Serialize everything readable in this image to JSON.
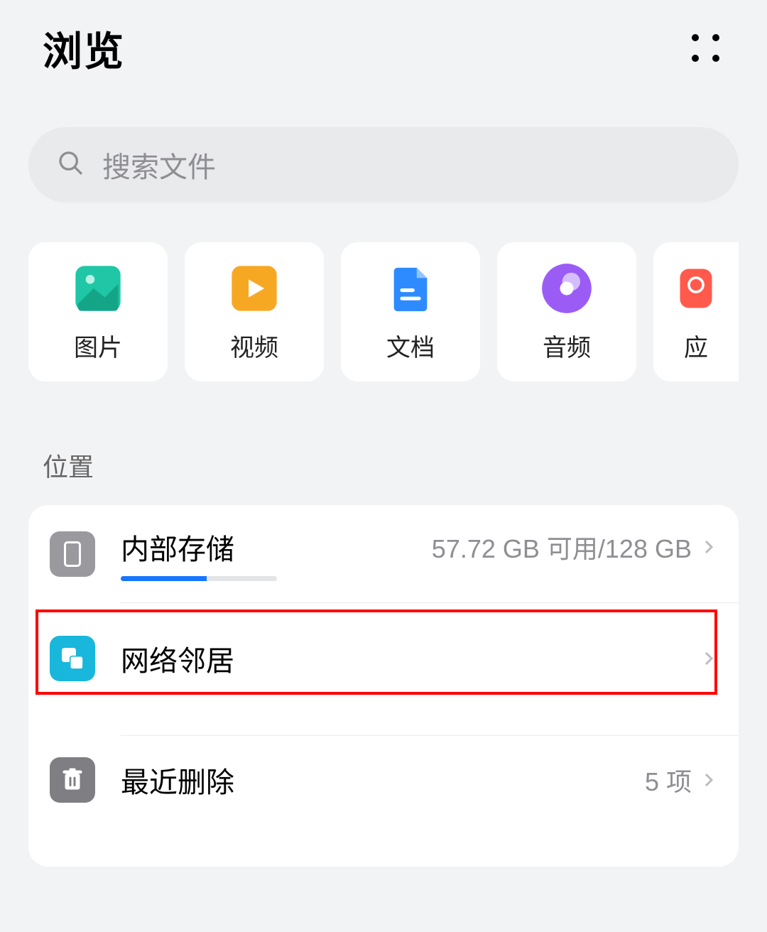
{
  "header": {
    "title": "浏览"
  },
  "search": {
    "placeholder": "搜索文件"
  },
  "categories": [
    {
      "id": "images",
      "label": "图片"
    },
    {
      "id": "videos",
      "label": "视频"
    },
    {
      "id": "docs",
      "label": "文档"
    },
    {
      "id": "audio",
      "label": "音频"
    },
    {
      "id": "apps",
      "label": "应"
    }
  ],
  "section": {
    "locations_label": "位置"
  },
  "locations": {
    "internal": {
      "title": "内部存储",
      "subtitle": "57.72 GB 可用/128 GB",
      "used_percent": 55
    },
    "network": {
      "title": "网络邻居"
    },
    "trash": {
      "title": "最近删除",
      "subtitle": "5 项"
    }
  },
  "colors": {
    "image_icon": "#1fc7a6",
    "video_icon": "#f7a823",
    "doc_icon": "#2e8bff",
    "audio_icon": "#9b5cf6",
    "app_icon": "#ff5a4c",
    "phone_icon_bg": "#9a9a9e",
    "network_icon_bg": "#18b7db",
    "trash_icon_bg": "#7f7f83",
    "progress_fill": "#1676ff",
    "highlight_border": "#ff0000"
  }
}
